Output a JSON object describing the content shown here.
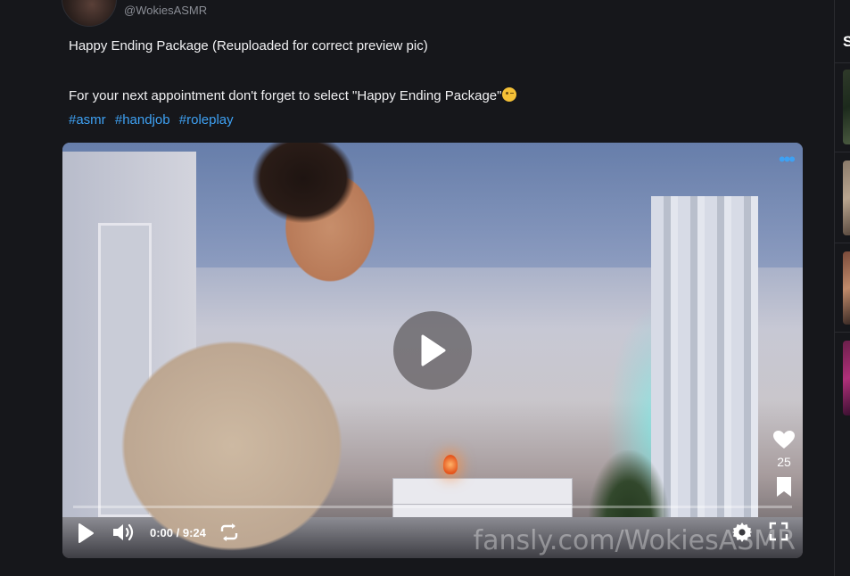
{
  "post": {
    "handle": "@WokiesASMR",
    "title_line": "Happy Ending Package (Reuploaded for correct preview pic)",
    "body_line": "For your next appointment don't forget to select \"Happy Ending Package\"",
    "tags": [
      "#asmr",
      "#handjob",
      "#roleplay"
    ]
  },
  "video": {
    "watermark": "fansly.com/WokiesASMR",
    "time_display": "0:00 / 9:24",
    "progress": 0,
    "likes": "25"
  },
  "right_panel": {
    "title": "S"
  },
  "colors": {
    "background": "#16171b",
    "accent": "#3ea1f3",
    "text": "#f1f1f3",
    "muted": "#8b8e96"
  },
  "icons": {
    "play": "play-icon",
    "volume": "volume-icon",
    "loop": "loop-icon",
    "settings": "gear-icon",
    "fullscreen": "fullscreen-icon",
    "like": "heart-icon",
    "bookmark": "bookmark-icon",
    "menu": "more-dots-icon"
  }
}
